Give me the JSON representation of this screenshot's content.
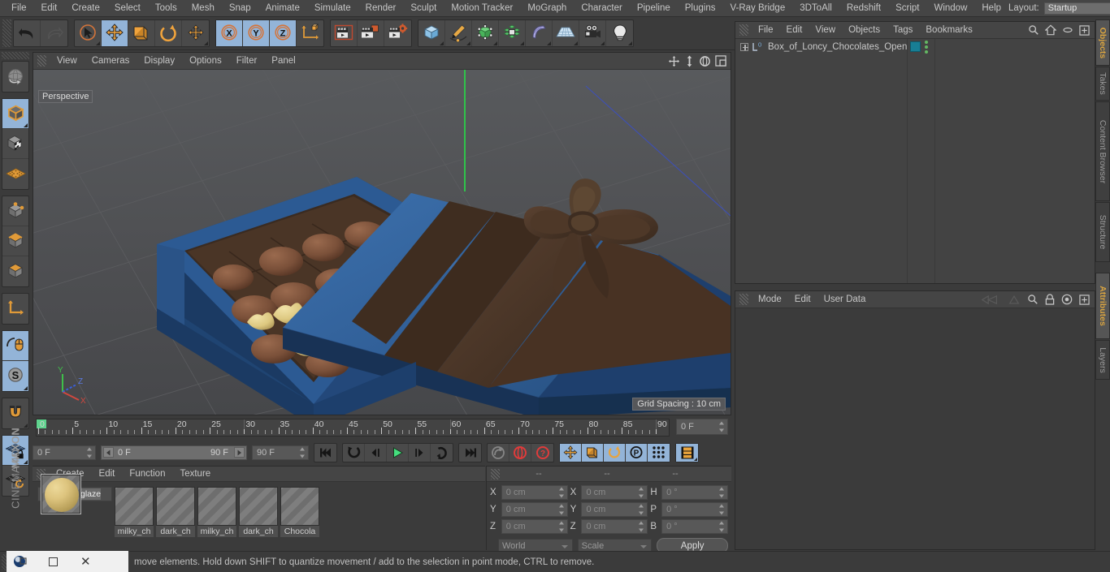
{
  "app": {
    "title": "CINEMA 4D",
    "brand_top": "MAXON"
  },
  "menubar": {
    "items": [
      "File",
      "Edit",
      "Create",
      "Select",
      "Tools",
      "Mesh",
      "Snap",
      "Animate",
      "Simulate",
      "Render",
      "Sculpt",
      "Motion Tracker",
      "MoGraph",
      "Character",
      "Pipeline",
      "Plugins",
      "V-Ray Bridge",
      "3DToAll",
      "Redshift",
      "Script",
      "Window",
      "Help"
    ],
    "layout_label": "Layout:",
    "layout_value": "Startup",
    "search_icon": "search-icon"
  },
  "toolbar": {
    "groups": [
      {
        "name": "undo-redo",
        "buttons": [
          {
            "icon": "undo-icon",
            "label": "Undo",
            "active": false
          },
          {
            "icon": "redo-icon",
            "label": "Redo",
            "active": false
          }
        ]
      },
      {
        "name": "transform-tools",
        "buttons": [
          {
            "icon": "live-selection-icon",
            "label": "Live Selection",
            "active": false
          },
          {
            "icon": "move-icon",
            "label": "Move",
            "active": true
          },
          {
            "icon": "scale-icon",
            "label": "Scale",
            "active": false
          },
          {
            "icon": "rotate-icon",
            "label": "Rotate",
            "active": false
          },
          {
            "icon": "move-alt-icon",
            "label": "Move Alt",
            "active": false
          }
        ]
      },
      {
        "name": "axis-locks",
        "buttons": [
          {
            "icon": "x-axis-icon",
            "label": "X",
            "active": true
          },
          {
            "icon": "y-axis-icon",
            "label": "Y",
            "active": true
          },
          {
            "icon": "z-axis-icon",
            "label": "Z",
            "active": true
          },
          {
            "icon": "world-object-axis-icon",
            "label": "World/Object",
            "active": false
          }
        ]
      },
      {
        "name": "render-tools",
        "buttons": [
          {
            "icon": "render-view-icon",
            "label": "Render View",
            "active": false
          },
          {
            "icon": "render-region-icon",
            "label": "Render to Picture Viewer",
            "active": false
          },
          {
            "icon": "render-settings-icon",
            "label": "Render Settings",
            "active": false
          }
        ]
      },
      {
        "name": "object-creation",
        "buttons": [
          {
            "icon": "cube-primitive-icon",
            "label": "Add Cube Object",
            "active": false
          },
          {
            "icon": "spline-pen-icon",
            "label": "Add Spline Object",
            "active": false
          },
          {
            "icon": "generator-icon",
            "label": "Add Generator Object",
            "active": false
          },
          {
            "icon": "array-icon",
            "label": "Add Modeling Object",
            "active": false
          },
          {
            "icon": "bend-deformer-icon",
            "label": "Add Deformer Object",
            "active": false
          },
          {
            "icon": "floor-environment-icon",
            "label": "Add Environment Object",
            "active": false
          },
          {
            "icon": "camera-icon",
            "label": "Add Camera Object",
            "active": false
          },
          {
            "icon": "light-icon",
            "label": "Add Light Object",
            "active": false
          }
        ]
      }
    ]
  },
  "left_toolbar": {
    "groups": [
      [
        {
          "icon": "globe-undo-icon",
          "label": "Undo View",
          "active": false
        }
      ],
      [
        {
          "icon": "cube-editable-icon",
          "label": "Make Editable",
          "active": true
        },
        {
          "icon": "texture-axis-icon",
          "label": "Model / Texture Mode",
          "active": false
        },
        {
          "icon": "points-grid-icon",
          "label": "Enable Axis Modification",
          "active": false
        }
      ],
      [
        {
          "icon": "point-mode-icon",
          "label": "Points Mode",
          "active": false
        },
        {
          "icon": "edge-mode-icon",
          "label": "Edges Mode",
          "active": false
        },
        {
          "icon": "polygon-mode-icon",
          "label": "Polygons Mode",
          "active": false
        }
      ],
      [
        {
          "icon": "object-axis-icon",
          "label": "Object Axis",
          "active": false
        }
      ],
      [
        {
          "icon": "viewport-mouse-icon",
          "label": "Viewport Solo Off",
          "active": true
        },
        {
          "icon": "soft-selection-icon",
          "label": "Soft Selection",
          "active": true
        }
      ],
      [
        {
          "icon": "magnet-icon",
          "label": "Magnet",
          "active": false
        }
      ],
      [
        {
          "icon": "workplane-lock-icon",
          "label": "Lock Workplane",
          "active": true
        },
        {
          "icon": "workplane-rotate-icon",
          "label": "Planar Workplane",
          "active": false
        }
      ]
    ]
  },
  "viewport": {
    "menu_items": [
      "View",
      "Cameras",
      "Display",
      "Options",
      "Filter",
      "Panel"
    ],
    "nav_icons": [
      "pan-icon",
      "dolly-icon",
      "rotate-view-icon",
      "maximize-viewport-icon"
    ],
    "perspective_label": "Perspective",
    "grid_spacing_label": "Grid Spacing : 10 cm",
    "axis_gizmo": {
      "x": "X",
      "y": "Y",
      "z": "Z",
      "x_color": "#d1483f",
      "y_color": "#3fbf4a",
      "z_color": "#3a5fd9"
    },
    "scene": {
      "description": "Open blue gift box of chocolates with a brown ribbon bow",
      "box_color": "#2b5488",
      "box_color_dark": "#1e3e68",
      "lid_color": "#31609b",
      "ribbon_color": "#4a3528",
      "chocolate_color": "#7d5440",
      "glaze_color": "#e0cb8c"
    }
  },
  "timeline": {
    "ticks": [
      0,
      5,
      10,
      15,
      20,
      25,
      30,
      35,
      40,
      45,
      50,
      55,
      60,
      65,
      70,
      75,
      80,
      85,
      90
    ],
    "start": 0,
    "end": 90,
    "current_frame_field": "0 F"
  },
  "playback": {
    "current_frame": "0 F",
    "range_start": "0 F",
    "range_end": "90 F",
    "end_frame": "90 F",
    "buttons": [
      {
        "icon": "go-to-start-icon",
        "label": "Go to Start",
        "active": false
      },
      {
        "icon": "step-back-keyframe-icon",
        "label": "Go to Previous Key",
        "active": false
      },
      {
        "icon": "step-back-frame-icon",
        "label": "Go to Previous Frame",
        "active": false
      },
      {
        "icon": "play-icon",
        "label": "Play Forwards",
        "active": false
      },
      {
        "icon": "step-forward-frame-icon",
        "label": "Go to Next Frame",
        "active": false
      },
      {
        "icon": "step-forward-keyframe-icon",
        "label": "Go to Next Key",
        "active": false
      },
      {
        "icon": "go-to-end-icon",
        "label": "Go to End",
        "active": false
      },
      {
        "icon": "record-keyframe-icon",
        "label": "Record Active Objects",
        "active": false
      },
      {
        "icon": "autokeying-icon",
        "label": "Autokeying",
        "active": false
      },
      {
        "icon": "keyframe-selection-icon",
        "label": "Keyframe Selection",
        "active": false
      },
      {
        "icon": "record-position-icon",
        "label": "Position",
        "active": true
      },
      {
        "icon": "record-scale-icon",
        "label": "Scale",
        "active": true
      },
      {
        "icon": "record-rotation-icon",
        "label": "Rotation",
        "active": true
      },
      {
        "icon": "record-pla-icon",
        "label": "Parameter (PLA)",
        "active": true
      },
      {
        "icon": "point-level-animation-icon",
        "label": "Point Level Animation",
        "active": true
      },
      {
        "icon": "timeline-toggle-icon",
        "label": "Animation Mode",
        "active": true
      }
    ]
  },
  "material_manager": {
    "menu_items": [
      "Create",
      "Edit",
      "Function",
      "Texture"
    ],
    "materials": [
      {
        "name": "glaze",
        "selected": true,
        "has_preview": true
      },
      {
        "name": "milky_ch",
        "selected": false,
        "has_preview": false
      },
      {
        "name": "dark_ch",
        "selected": false,
        "has_preview": false
      },
      {
        "name": "milky_ch",
        "selected": false,
        "has_preview": false
      },
      {
        "name": "dark_ch",
        "selected": false,
        "has_preview": false
      },
      {
        "name": "Chocola",
        "selected": false,
        "has_preview": false
      }
    ]
  },
  "coordinates": {
    "headers": [
      "--",
      "--",
      "--"
    ],
    "rows": [
      {
        "pos_axis": "X",
        "pos_value": "0 cm",
        "size_axis": "X",
        "size_value": "0 cm",
        "rot_axis": "H",
        "rot_value": "0 °"
      },
      {
        "pos_axis": "Y",
        "pos_value": "0 cm",
        "size_axis": "Y",
        "size_value": "0 cm",
        "rot_axis": "P",
        "rot_value": "0 °"
      },
      {
        "pos_axis": "Z",
        "pos_value": "0 cm",
        "size_axis": "Z",
        "size_value": "0 cm",
        "rot_axis": "B",
        "rot_value": "0 °"
      }
    ],
    "coord_system": "World",
    "size_mode": "Scale",
    "apply_label": "Apply"
  },
  "object_manager": {
    "menu_items": [
      "File",
      "Edit",
      "View",
      "Objects",
      "Tags",
      "Bookmarks"
    ],
    "header_icons": [
      "search-icon",
      "home-icon",
      "ellipse-icon",
      "plus-box-icon"
    ],
    "objects": [
      {
        "name": "Box_of_Loncy_Chocolates_Open",
        "layer_badge": "0",
        "tag_color": "#187e94",
        "expandable": true
      }
    ]
  },
  "attribute_manager": {
    "menu_items": [
      "Mode",
      "Edit",
      "User Data"
    ],
    "header_icons": [
      "arrow-left-icon",
      "arrow-right-icon",
      "search-icon",
      "lock-icon",
      "target-icon",
      "plus-box-icon"
    ]
  },
  "vertical_tabs": {
    "right_top": [
      {
        "label": "Objects",
        "active": true
      },
      {
        "label": "Takes",
        "active": false
      },
      {
        "label": "Content Browser",
        "active": false
      },
      {
        "label": "Structure",
        "active": false
      }
    ],
    "right_bottom": [
      {
        "label": "Attributes",
        "active": true
      },
      {
        "label": "Layers",
        "active": false
      }
    ]
  },
  "statusbar": {
    "message": "move elements. Hold down SHIFT to quantize movement / add to the selection in point mode, CTRL to remove."
  },
  "taskbar": {
    "app_icon": "cinema4d-icon",
    "restore_icon": "restore-window-icon",
    "minimize_icon": "minimize-window-icon",
    "close_icon": "close-window-icon"
  }
}
